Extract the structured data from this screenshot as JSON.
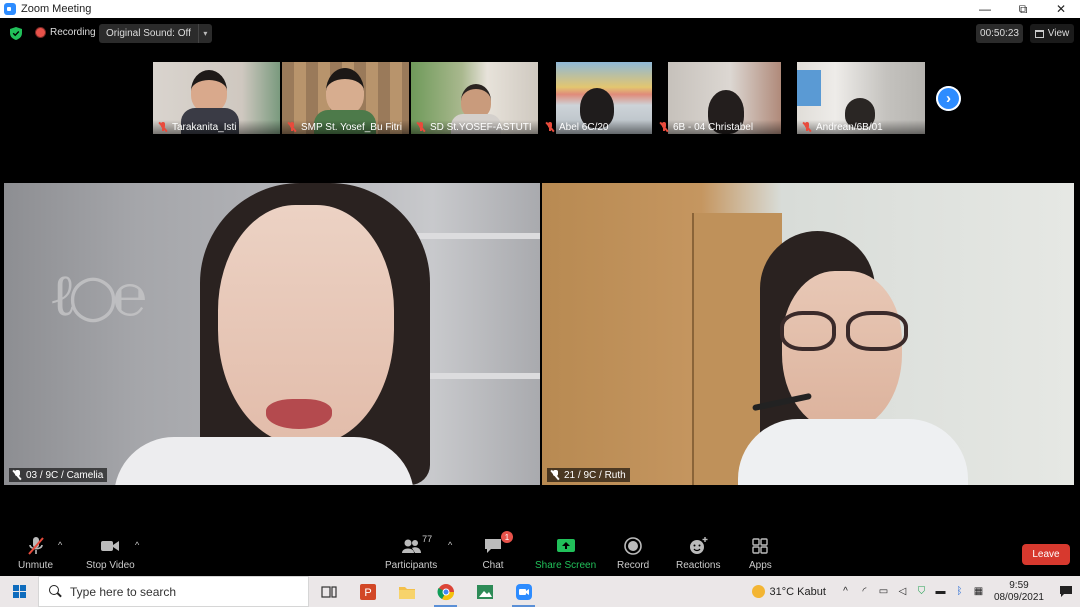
{
  "window": {
    "title": "Zoom Meeting",
    "controls": [
      "—",
      "⧉",
      "✕"
    ]
  },
  "topbar": {
    "recording_label": "Recording",
    "original_sound_label": "Original Sound: Off",
    "timer": "00:50:23",
    "view_label": "View"
  },
  "gallery_strip": [
    {
      "name": "Tarakanita_Isti"
    },
    {
      "name": "SMP St. Yosef_Bu Fitri"
    },
    {
      "name": "SD St.YOSEF-ASTUTI"
    },
    {
      "name": "Abel 6C/20"
    },
    {
      "name": "6B - 04 Christabel"
    },
    {
      "name": "Andrean/6B/01"
    }
  ],
  "main_tiles": [
    {
      "name": "03 / 9C / Camelia",
      "active": true
    },
    {
      "name": "21 / 9C / Ruth",
      "active": false
    }
  ],
  "toolbar": {
    "unmute": "Unmute",
    "stop_video": "Stop Video",
    "participants": "Participants",
    "participants_count": "77",
    "chat": "Chat",
    "chat_badge": "1",
    "share_screen": "Share Screen",
    "record": "Record",
    "reactions": "Reactions",
    "apps": "Apps",
    "leave": "Leave"
  },
  "taskbar": {
    "search_placeholder": "Type here to search",
    "weather": "31°C  Kabut",
    "time": "9:59",
    "date": "08/09/2021"
  },
  "colors": {
    "accent": "#2d8cff",
    "active_speaker": "#c8e86b",
    "leave": "#d7392e",
    "share": "#21c05a",
    "muted": "#e84b3c"
  }
}
